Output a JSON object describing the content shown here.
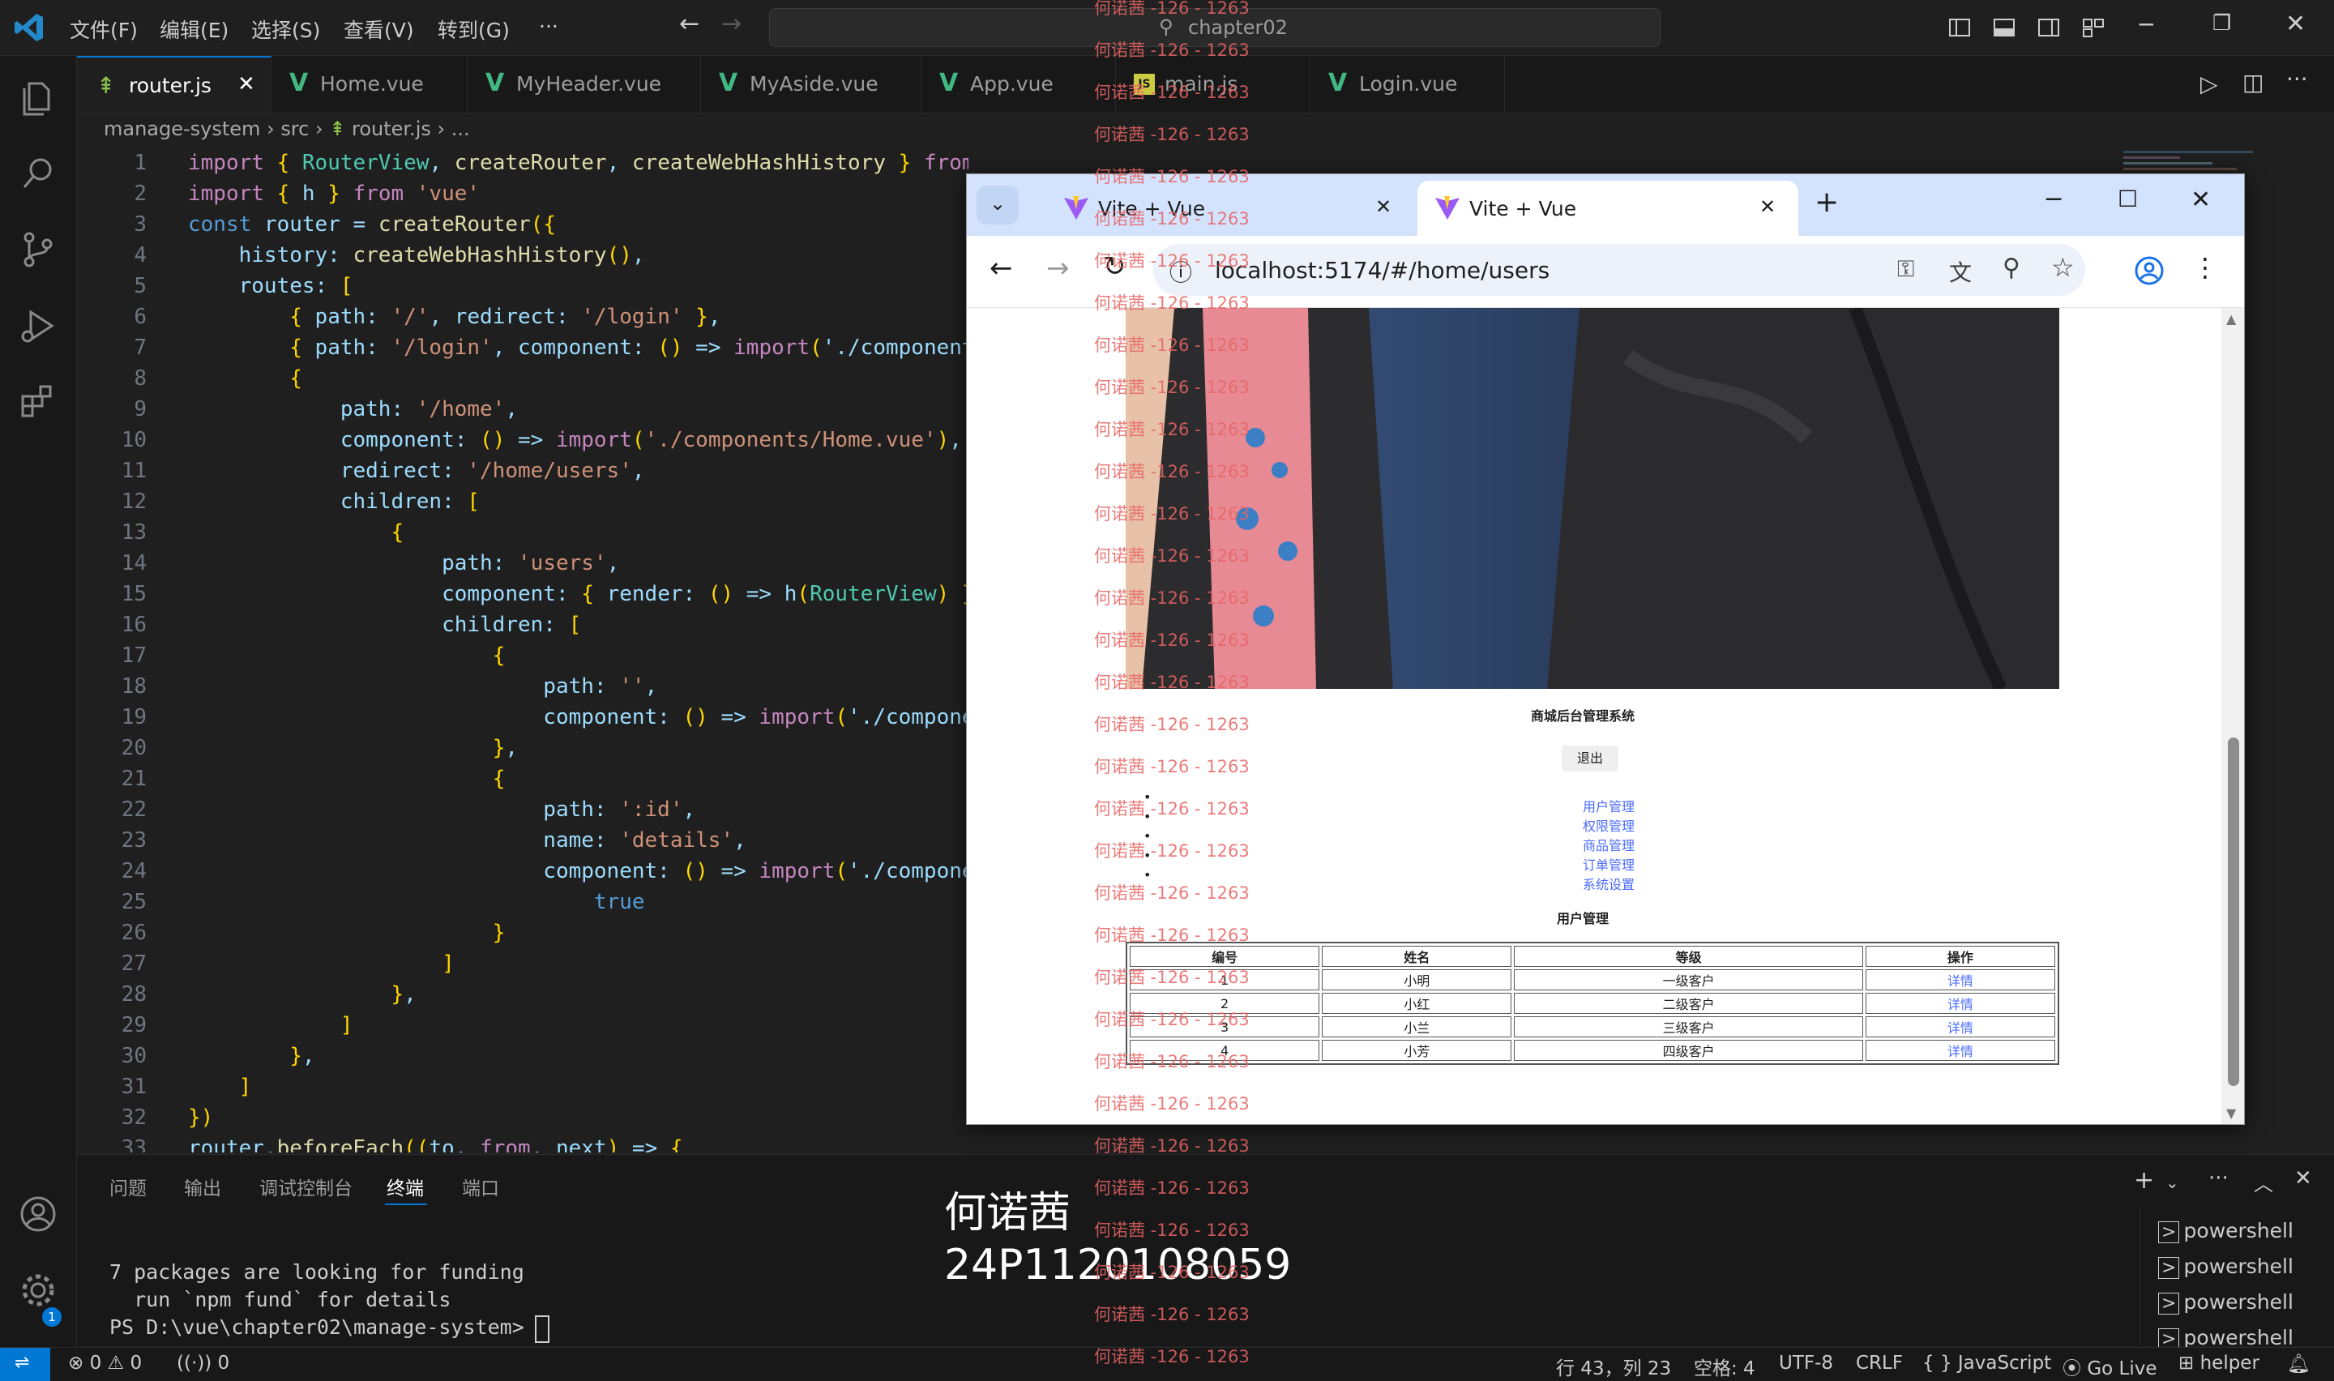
{
  "titlebar": {
    "menus": [
      "文件(F)",
      "编辑(E)",
      "选择(S)",
      "查看(V)",
      "转到(G)",
      "···"
    ],
    "search": "chapter02"
  },
  "tabs": [
    {
      "label": "router.js",
      "icon": "js-route-icon",
      "active": true
    },
    {
      "label": "Home.vue",
      "icon": "vue-icon"
    },
    {
      "label": "MyHeader.vue",
      "icon": "vue-icon"
    },
    {
      "label": "MyAside.vue",
      "icon": "vue-icon"
    },
    {
      "label": "App.vue",
      "icon": "vue-icon"
    },
    {
      "label": "main.js",
      "icon": "js-icon"
    },
    {
      "label": "Login.vue",
      "icon": "vue-icon"
    }
  ],
  "breadcrumb": [
    "manage-system",
    "src",
    "router.js",
    "..."
  ],
  "code_lines": [
    {
      "n": "1",
      "text": "import { RouterView, createRouter, createWebHashHistory } from \"vue-router\";"
    },
    {
      "n": "2",
      "text": "import { h } from 'vue'"
    },
    {
      "n": "3",
      "text": "const router = createRouter({"
    },
    {
      "n": "4",
      "text": "    history: createWebHashHistory(),"
    },
    {
      "n": "5",
      "text": "    routes: ["
    },
    {
      "n": "6",
      "text": "        { path: '/', redirect: '/login' },"
    },
    {
      "n": "7",
      "text": "        { path: '/login', component: () => import('./components"
    },
    {
      "n": "8",
      "text": "        {"
    },
    {
      "n": "9",
      "text": "            path: '/home',"
    },
    {
      "n": "10",
      "text": "            component: () => import('./components/Home.vue'),"
    },
    {
      "n": "11",
      "text": "            redirect: '/home/users',"
    },
    {
      "n": "12",
      "text": "            children: ["
    },
    {
      "n": "13",
      "text": "                {"
    },
    {
      "n": "14",
      "text": "                    path: 'users',"
    },
    {
      "n": "15",
      "text": "                    component: { render: () => h(RouterView) },"
    },
    {
      "n": "16",
      "text": "                    children: ["
    },
    {
      "n": "17",
      "text": "                        {"
    },
    {
      "n": "18",
      "text": "                            path: '',"
    },
    {
      "n": "19",
      "text": "                            component: () => import('./componen"
    },
    {
      "n": "20",
      "text": "                        },"
    },
    {
      "n": "21",
      "text": "                        {"
    },
    {
      "n": "22",
      "text": "                            path: ':id',"
    },
    {
      "n": "23",
      "text": "                            name: 'details',"
    },
    {
      "n": "24",
      "text": "                            component: () => import('./componen"
    },
    {
      "n": "25",
      "text": "                                true"
    },
    {
      "n": "26",
      "text": "                        }"
    },
    {
      "n": "27",
      "text": "                    ]"
    },
    {
      "n": "28",
      "text": "                },"
    },
    {
      "n": "29",
      "text": "            ]"
    },
    {
      "n": "30",
      "text": "        },"
    },
    {
      "n": "31",
      "text": "    ]"
    },
    {
      "n": "32",
      "text": "})"
    },
    {
      "n": "33",
      "text": "router.beforeEach((to, from, next) => {"
    }
  ],
  "panel": {
    "tabs": [
      "问题",
      "输出",
      "调试控制台",
      "终端",
      "端口"
    ],
    "active_tab": "终端",
    "terminal_lines": [
      "7 packages are looking for funding",
      "  run `npm fund` for details",
      "PS D:\\vue\\chapter02\\manage-system> "
    ],
    "shells": [
      "powershell",
      "powershell",
      "powershell",
      "powershell"
    ]
  },
  "overlay": {
    "name": "何诺茜",
    "id": "24P1120108059"
  },
  "watermark_text": "何诺茜 -126 - 1263",
  "statusbar": {
    "errors": "0",
    "warnings": "0",
    "ports": "0",
    "position": "行 43，列 23",
    "spaces": "空格: 4",
    "encoding": "UTF-8",
    "eol": "CRLF",
    "language": "{ } JavaScript",
    "golive": "Go Live",
    "helper": "helper",
    "bell_badge": "1"
  },
  "browser": {
    "tabs": [
      "Vite + Vue",
      "Vite + Vue"
    ],
    "url": "localhost:5174/#/home/users",
    "page": {
      "header_title": "商城后台管理系统",
      "logout": "退出",
      "nav": [
        "用户管理",
        "权限管理",
        "商品管理",
        "订单管理",
        "系统设置"
      ],
      "section_title": "用户管理",
      "table": {
        "headers": [
          "编号",
          "姓名",
          "等级",
          "操作"
        ],
        "rows": [
          [
            "1",
            "小明",
            "一级客户",
            "详情"
          ],
          [
            "2",
            "小红",
            "二级客户",
            "详情"
          ],
          [
            "3",
            "小兰",
            "三级客户",
            "详情"
          ],
          [
            "4",
            "小芳",
            "四级客户",
            "详情"
          ]
        ]
      }
    }
  },
  "colors": {
    "accent": "#0078d4",
    "vue_green": "#41b883",
    "link": "#4b6bff",
    "watermark": "#e86464"
  }
}
